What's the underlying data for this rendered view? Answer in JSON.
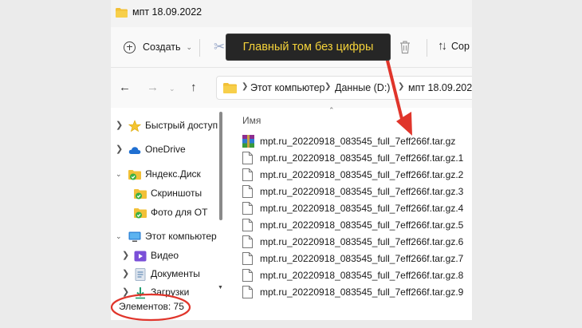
{
  "window": {
    "title": "мпт 18.09.2022"
  },
  "toolbar": {
    "create_label": "Создать",
    "sort_label": "Сор"
  },
  "address": {
    "crumbs": [
      "Этот компьютер",
      "Данные (D:)",
      "мпт 18.09.2022"
    ]
  },
  "sidebar": {
    "items": [
      {
        "label": "Быстрый доступ",
        "icon": "star-icon"
      },
      {
        "label": "OneDrive",
        "icon": "cloud-icon"
      },
      {
        "label": "Яндекс.Диск",
        "icon": "folder-sync-icon"
      },
      {
        "label": "Скриншоты",
        "icon": "folder-sync-icon"
      },
      {
        "label": "Фото для ОТ",
        "icon": "folder-sync-icon"
      },
      {
        "label": "Этот компьютер",
        "icon": "monitor-icon"
      },
      {
        "label": "Видео",
        "icon": "video-folder-icon"
      },
      {
        "label": "Документы",
        "icon": "documents-icon"
      },
      {
        "label": "Загрузки",
        "icon": "download-icon"
      }
    ]
  },
  "content": {
    "column_name": "Имя",
    "files": [
      "mpt.ru_20220918_083545_full_7eff266f.tar.gz",
      "mpt.ru_20220918_083545_full_7eff266f.tar.gz.1",
      "mpt.ru_20220918_083545_full_7eff266f.tar.gz.2",
      "mpt.ru_20220918_083545_full_7eff266f.tar.gz.3",
      "mpt.ru_20220918_083545_full_7eff266f.tar.gz.4",
      "mpt.ru_20220918_083545_full_7eff266f.tar.gz.5",
      "mpt.ru_20220918_083545_full_7eff266f.tar.gz.6",
      "mpt.ru_20220918_083545_full_7eff266f.tar.gz.7",
      "mpt.ru_20220918_083545_full_7eff266f.tar.gz.8",
      "mpt.ru_20220918_083545_full_7eff266f.tar.gz.9"
    ]
  },
  "status": {
    "items_count": "Элементов: 75"
  },
  "annotation": {
    "callout_text": "Главный том без цифры"
  },
  "colors": {
    "annotation_red": "#e0352b",
    "callout_text": "#f5d33a",
    "callout_bg": "#262626"
  }
}
